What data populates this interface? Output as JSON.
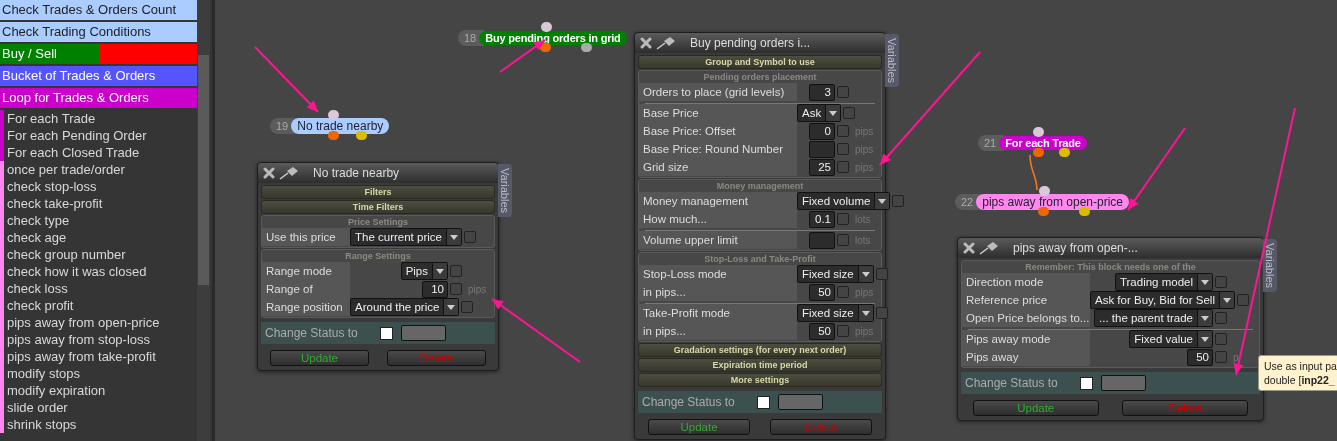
{
  "sidebar": {
    "categories": [
      {
        "label": "Check Trades & Orders Count",
        "color": "#aaccff"
      },
      {
        "label": "Check Trading Conditions",
        "color": "#aaccff"
      },
      {
        "label": "Buy / Sell",
        "color": "#008000",
        "split": {
          "color": "#ff0000"
        }
      },
      {
        "label": "Bucket of Trades & Orders",
        "color": "#5555ff"
      },
      {
        "label": "Loop for Trades & Orders",
        "color": "#cc00cc"
      }
    ],
    "items": [
      {
        "label": "For each Trade",
        "color": "#cc00cc"
      },
      {
        "label": "For each Pending Order",
        "color": "#cc00cc"
      },
      {
        "label": "For each Closed Trade",
        "color": "#cc00cc"
      },
      {
        "label": "once per trade/order",
        "color": "#ff88ee"
      },
      {
        "label": "check stop-loss",
        "color": "#ff88ee"
      },
      {
        "label": "check take-profit",
        "color": "#ff88ee"
      },
      {
        "label": "check type",
        "color": "#ff88ee"
      },
      {
        "label": "check age",
        "color": "#ff88ee"
      },
      {
        "label": "check group number",
        "color": "#ff88ee"
      },
      {
        "label": "check how it was closed",
        "color": "#ff88ee"
      },
      {
        "label": "check loss",
        "color": "#ff88ee"
      },
      {
        "label": "check profit",
        "color": "#ff88ee"
      },
      {
        "label": "pips away from open-price",
        "color": "#ff88ee"
      },
      {
        "label": "pips away from stop-loss",
        "color": "#ff88ee"
      },
      {
        "label": "pips away from take-profit",
        "color": "#ff88ee"
      },
      {
        "label": "modify stops",
        "color": "#ff88ee"
      },
      {
        "label": "modify expiration",
        "color": "#ff88ee"
      },
      {
        "label": "slide order",
        "color": "#ff88ee"
      },
      {
        "label": "shrink stops",
        "color": "#ff88ee"
      }
    ]
  },
  "nodes": [
    {
      "number": "19",
      "label": "No trade nearby",
      "color": "#aaccff",
      "bold": false,
      "outputs": [
        {
          "color": "#ee6600"
        },
        {
          "color": "#ddbb00"
        }
      ]
    },
    {
      "number": "18",
      "label": "Buy pending orders in grid",
      "color": "#008000",
      "bold": true,
      "outputs": [
        {
          "color": "#ee6600"
        },
        {
          "color": "#aaaaaa"
        }
      ]
    },
    {
      "number": "21",
      "label": "For each Trade",
      "color": "#cc00cc",
      "bold": true,
      "outputs": [
        {
          "color": "#ee6600"
        },
        {
          "color": "#ddbb00"
        }
      ]
    },
    {
      "number": "22",
      "label": "pips away from open-price",
      "color": "#ff88ee",
      "bold": false,
      "outputs": [
        {
          "color": "#ee6600"
        },
        {
          "color": "#ddbb00"
        }
      ]
    }
  ],
  "panels": [
    {
      "title": "No trade nearby",
      "side_tab": "Variables",
      "sections": [
        {
          "kind": "bar",
          "label": "Filters"
        },
        {
          "kind": "bar",
          "label": "Time Filters"
        },
        {
          "kind": "group",
          "heading": "Price Settings",
          "blocks": [
            [
              {
                "label": "Use this price",
                "kind": "select",
                "value": "The current price",
                "checked": false
              }
            ]
          ]
        },
        {
          "kind": "group",
          "heading": "Range Settings",
          "blocks": [
            [
              {
                "label": "Range mode",
                "kind": "select",
                "value": "Pips",
                "checked": false
              },
              {
                "label": "Range of",
                "kind": "number",
                "value": "10",
                "checked": false,
                "unit": "pips"
              },
              {
                "label": "Range position",
                "kind": "select",
                "value": "Around the price",
                "checked": false
              }
            ]
          ]
        }
      ],
      "status": {
        "label": "Change Status to",
        "checked": false
      },
      "buttons": [
        {
          "label": "Update",
          "kind": "update"
        },
        {
          "label": "Delete",
          "kind": "delete"
        }
      ]
    },
    {
      "title": "Buy pending orders i...",
      "side_tab": "Variables",
      "sections": [
        {
          "kind": "bar",
          "label": "Group and Symbol to use"
        },
        {
          "kind": "group",
          "heading": "Pending orders placement",
          "blocks": [
            [
              {
                "label": "Orders to place (grid levels)",
                "kind": "number",
                "value": "3",
                "checked": false
              }
            ],
            [
              {
                "label": "Base Price",
                "kind": "select",
                "value": "Ask",
                "checked": false
              },
              {
                "label": "Base Price: Offset",
                "kind": "number",
                "value": "0",
                "checked": false,
                "unit": "pips"
              },
              {
                "label": "Base Price: Round Number",
                "kind": "number",
                "checked": false,
                "unit": "pips"
              },
              {
                "label": "Grid size",
                "kind": "number",
                "value": "25",
                "checked": false,
                "unit": "pips"
              }
            ]
          ]
        },
        {
          "kind": "group",
          "heading": "Money management",
          "blocks": [
            [
              {
                "label": "Money management",
                "kind": "select",
                "value": "Fixed volume",
                "checked": false
              },
              {
                "label": "How much...",
                "kind": "number",
                "value": "0.1",
                "checked": false,
                "unit": "lots"
              }
            ],
            [
              {
                "label": "Volume upper limit",
                "kind": "number",
                "checked": false,
                "unit": "lots"
              }
            ]
          ]
        },
        {
          "kind": "group",
          "heading": "Stop-Loss and Take-Profit",
          "blocks": [
            [
              {
                "label": "Stop-Loss mode",
                "kind": "select",
                "value": "Fixed size",
                "checked": false
              },
              {
                "label": "in pips...",
                "kind": "number",
                "value": "50",
                "checked": false,
                "unit": "pips"
              }
            ],
            [
              {
                "label": "Take-Profit mode",
                "kind": "select",
                "value": "Fixed size",
                "checked": false
              },
              {
                "label": "in pips...",
                "kind": "number",
                "value": "50",
                "checked": false,
                "unit": "pips"
              }
            ]
          ]
        },
        {
          "kind": "bar",
          "label": "Gradation settings (for every next order)"
        },
        {
          "kind": "bar",
          "label": "Expiration time period"
        },
        {
          "kind": "bar",
          "label": "More settings"
        }
      ],
      "status": {
        "label": "Change Status to",
        "checked": false
      },
      "buttons": [
        {
          "label": "Update",
          "kind": "update"
        },
        {
          "label": "Delete",
          "kind": "delete"
        }
      ]
    },
    {
      "title": "pips away from open-...",
      "side_tab": "Variables",
      "sections": [
        {
          "kind": "group",
          "heading": "Remember: This block needs one of the",
          "blocks": [
            [
              {
                "label": "Direction mode",
                "kind": "select",
                "value": "Trading model",
                "checked": false
              },
              {
                "label": "Reference price",
                "kind": "select",
                "value": "Ask for Buy, Bid for Sell",
                "checked": false
              },
              {
                "label": "Open Price belongs to...",
                "kind": "select",
                "value": "... the parent trade",
                "checked": false
              }
            ],
            [
              {
                "label": "Pips away mode",
                "kind": "select",
                "value": "Fixed value",
                "checked": false
              },
              {
                "label": "Pips away",
                "kind": "number",
                "value": "50",
                "checked": false,
                "unit": "p"
              }
            ]
          ]
        }
      ],
      "status": {
        "label": "Change Status to",
        "checked": false
      },
      "buttons": [
        {
          "label": "Update",
          "kind": "update"
        },
        {
          "label": "Delete",
          "kind": "delete"
        }
      ]
    }
  ],
  "tooltip": {
    "lines": [
      "Use as input pa",
      "double [**inp22_**"
    ]
  }
}
